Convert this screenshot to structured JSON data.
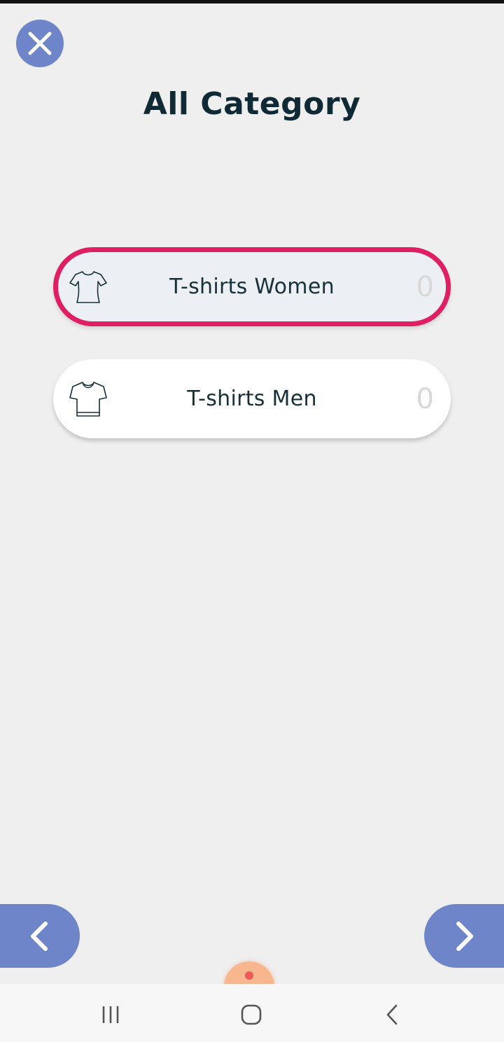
{
  "header": {
    "title": "All Category",
    "close_icon": "close-icon"
  },
  "categories": [
    {
      "label": "T-shirts Women",
      "count": "0",
      "icon": "womens-tshirt-icon",
      "selected": true
    },
    {
      "label": "T-shirts Men",
      "count": "0",
      "icon": "mens-tshirt-icon",
      "selected": false
    }
  ],
  "navigation": {
    "prev_icon": "chevron-left-icon",
    "next_icon": "chevron-right-icon"
  },
  "system_nav": {
    "recents_icon": "recent-apps-icon",
    "home_icon": "home-icon",
    "back_icon": "back-icon"
  },
  "colors": {
    "accent": "#6e86c9",
    "selected_border": "#e01f63",
    "title": "#102a35",
    "count": "#d8d8d8",
    "background": "#efefef"
  }
}
